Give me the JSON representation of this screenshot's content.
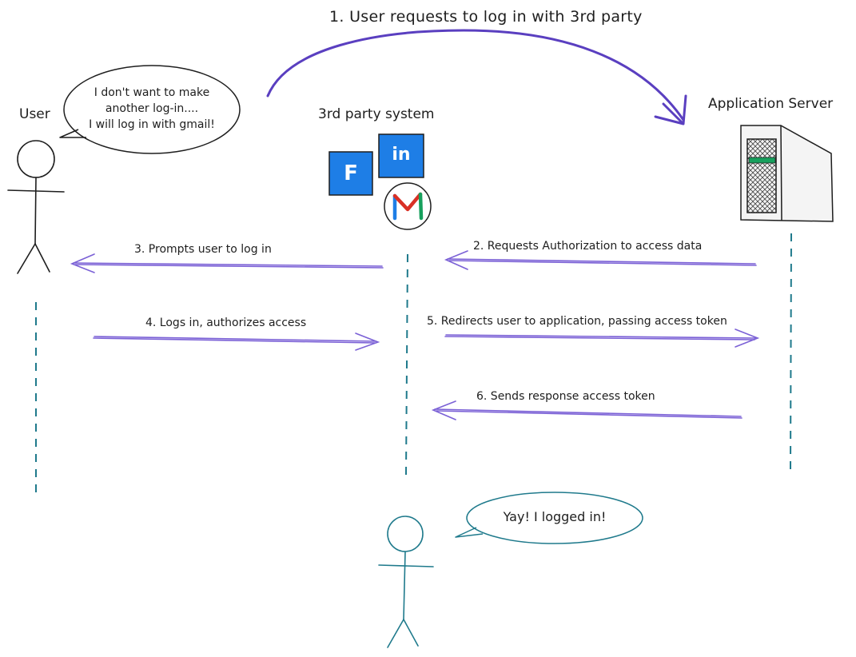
{
  "actors": {
    "user": "User",
    "third_party": "3rd party system",
    "app_server": "Application Server"
  },
  "speech": {
    "user_lines": [
      "I don't want to make",
      "another log-in....",
      "I will log in with gmail!"
    ],
    "user_done": "Yay! I logged in!"
  },
  "logos": {
    "facebook": "F",
    "linkedin": "in",
    "gmail": "M"
  },
  "steps": [
    "1. User requests to log in with 3rd party",
    "2. Requests Authorization to access data",
    "3. Prompts user to log in",
    "4. Logs in, authorizes access",
    "5. Redirects user to application, passing access token",
    "6. Sends response access token"
  ],
  "colors": {
    "arrow": "#7b61d6",
    "arc": "#5a3fc0",
    "lifeline": "#1f7a8c",
    "ink": "#1e1e1e",
    "teal_user": "#1f7a8c",
    "logo_blue": "#1e7ee6",
    "server_band": "#17a05d"
  }
}
